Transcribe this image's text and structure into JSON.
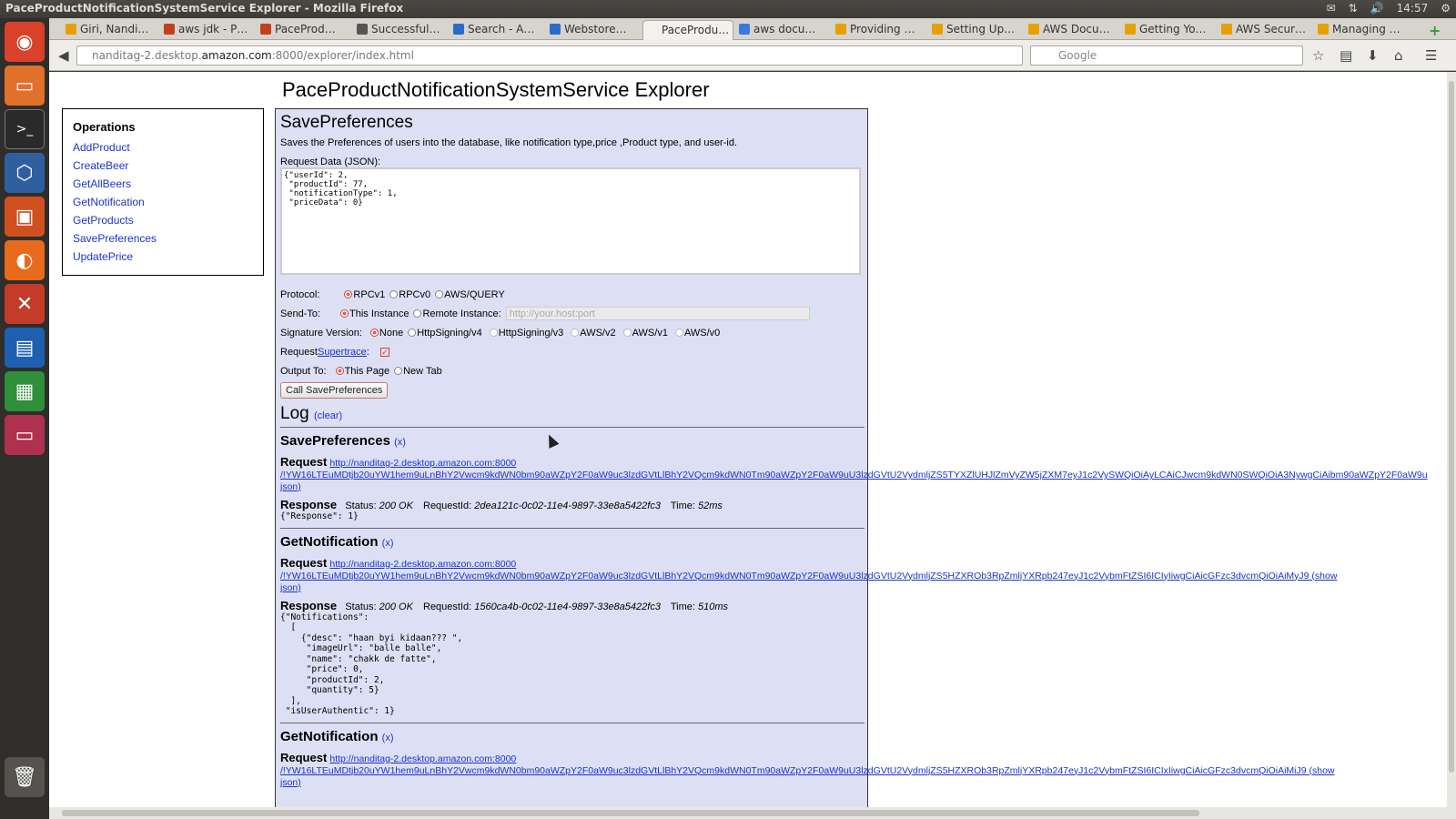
{
  "window": {
    "title": "PaceProductNotificationSystemService Explorer - Mozilla Firefox",
    "clock": "14:57"
  },
  "tabs": [
    {
      "label": "Giri, Nandi…",
      "color": "#e8a000"
    },
    {
      "label": "aws jdk - P…",
      "color": "#c04020"
    },
    {
      "label": "PaceProd…",
      "color": "#c04020"
    },
    {
      "label": "Successful…",
      "color": "#555"
    },
    {
      "label": "Search - A…",
      "color": "#2a6ac8"
    },
    {
      "label": "Webstore…",
      "color": "#2a6ac8"
    },
    {
      "label": "PaceProdu…",
      "color": "#f2f1ee"
    },
    {
      "label": "aws docu…",
      "color": "#3a78e0"
    },
    {
      "label": "Providing …",
      "color": "#e8a000"
    },
    {
      "label": "Setting Up…",
      "color": "#e8a000"
    },
    {
      "label": "AWS Docu…",
      "color": "#e8a000"
    },
    {
      "label": "Getting Yo…",
      "color": "#e8a000"
    },
    {
      "label": "AWS Secur…",
      "color": "#e8a000"
    },
    {
      "label": "Managing …",
      "color": "#e8a000"
    }
  ],
  "nav": {
    "url_prefix": "nanditag-2.desktop.",
    "url_host": "amazon.com",
    "url_suffix": ":8000/explorer/index.html",
    "search_placeholder": "Google"
  },
  "page": {
    "title": "PaceProductNotificationSystemService Explorer",
    "operations_heading": "Operations",
    "operations": [
      "AddProduct",
      "CreateBeer",
      "GetAllBeers",
      "GetNotification",
      "GetProducts",
      "SavePreferences",
      "UpdatePrice"
    ]
  },
  "panel": {
    "heading": "SavePreferences",
    "description": "Saves the Preferences of users into the database, like notification type,price ,Product type, and user-id.",
    "request_label": "Request Data (JSON):",
    "request_json": "{\"userId\": 2,\n \"productId\": 77,\n \"notificationType\": 1,\n \"priceData\": 0}",
    "protocol_label": "Protocol:",
    "protocol_options": [
      "RPCv1",
      "RPCv0",
      "AWS/QUERY"
    ],
    "sendto_label": "Send-To:",
    "sendto_options": [
      "This Instance",
      "Remote Instance:"
    ],
    "host_placeholder": "http://your.host:port",
    "signature_label": "Signature Version:",
    "signature_options": [
      "None",
      "HttpSigning/v4",
      "HttpSigning/v3",
      "AWS/v2",
      "AWS/v1",
      "AWS/v0"
    ],
    "supertrace_prefix": "Request ",
    "supertrace_link": "Supertrace",
    "supertrace_suffix": ":",
    "output_label": "Output To:",
    "output_options": [
      "This Page",
      "New Tab"
    ],
    "call_button": "Call SavePreferences"
  },
  "log": {
    "heading": "Log",
    "clear": "(clear)",
    "entries": [
      {
        "op": "SavePreferences",
        "x": "(x)",
        "request_label": "Request",
        "url1": "http://nanditag-2.desktop.amazon.com:8000",
        "url2": "/!YW16LTEuMDtjb20uYW1hem9uLnBhY2Vwcm9kdWN0bm90aWZpY2F0aW9uc3lzdGVtLlBhY2VQcm9kdWN0Tm90aWZpY2F0aW9uU3lzdGVtU2VydmljZS5TYXZlUHJlZmVyZW5jZXM7eyJ1c2VySWQiOiAyLCAiCJwcm9kdWN0SWQiOiA3NywgCiAibm90aWZpY2F0aW9u",
        "show_json": "json)",
        "response_label": "Response",
        "status_label": "Status:",
        "status": "200 OK",
        "requestid_label": "RequestId:",
        "requestid": "2dea121c-0c02-11e4-9897-33e8a5422fc3",
        "time_label": "Time:",
        "time": "52ms",
        "body": "{\"Response\": 1}"
      },
      {
        "op": "GetNotification",
        "x": "(x)",
        "request_label": "Request",
        "url1": "http://nanditag-2.desktop.amazon.com:8000",
        "url2": "/!YW16LTEuMDtjb20uYW1hem9uLnBhY2Vwcm9kdWN0bm90aWZpY2F0aW9uc3lzdGVtLlBhY2VQcm9kdWN0Tm90aWZpY2F0aW9uU3lzdGVtU2VydmljZS5HZXROb3RpZmljYXRpb247eyJ1c2VybmFtZSI6ICIyIiwgCiAicGFzc3dvcmQiOiAiMyJ9",
        "show": "(show",
        "show_json": "json)",
        "response_label": "Response",
        "status_label": "Status:",
        "status": "200 OK",
        "requestid_label": "RequestId:",
        "requestid": "1560ca4b-0c02-11e4-9897-33e8a5422fc3",
        "time_label": "Time:",
        "time": "510ms",
        "body": "{\"Notifications\":\n  [\n    {\"desc\": \"haan byi kidaan??? \",\n     \"imageUrl\": \"balle balle\",\n     \"name\": \"chakk de fatte\",\n     \"price\": 0,\n     \"productId\": 2,\n     \"quantity\": 5}\n  ],\n \"isUserAuthentic\": 1}"
      },
      {
        "op": "GetNotification",
        "x": "(x)",
        "request_label": "Request",
        "url1": "http://nanditag-2.desktop.amazon.com:8000",
        "url2": "/!YW16LTEuMDtjb20uYW1hem9uLnBhY2Vwcm9kdWN0bm90aWZpY2F0aW9uc3lzdGVtLlBhY2VQcm9kdWN0Tm90aWZpY2F0aW9uU3lzdGVtU2VydmljZS5HZXROb3RpZmljYXRpb247eyJ1c2VybmFtZSI6ICIxIiwgCiAicGFzc3dvcmQiOiAiMiJ9",
        "show": "(show",
        "show_json": "json)"
      }
    ]
  }
}
